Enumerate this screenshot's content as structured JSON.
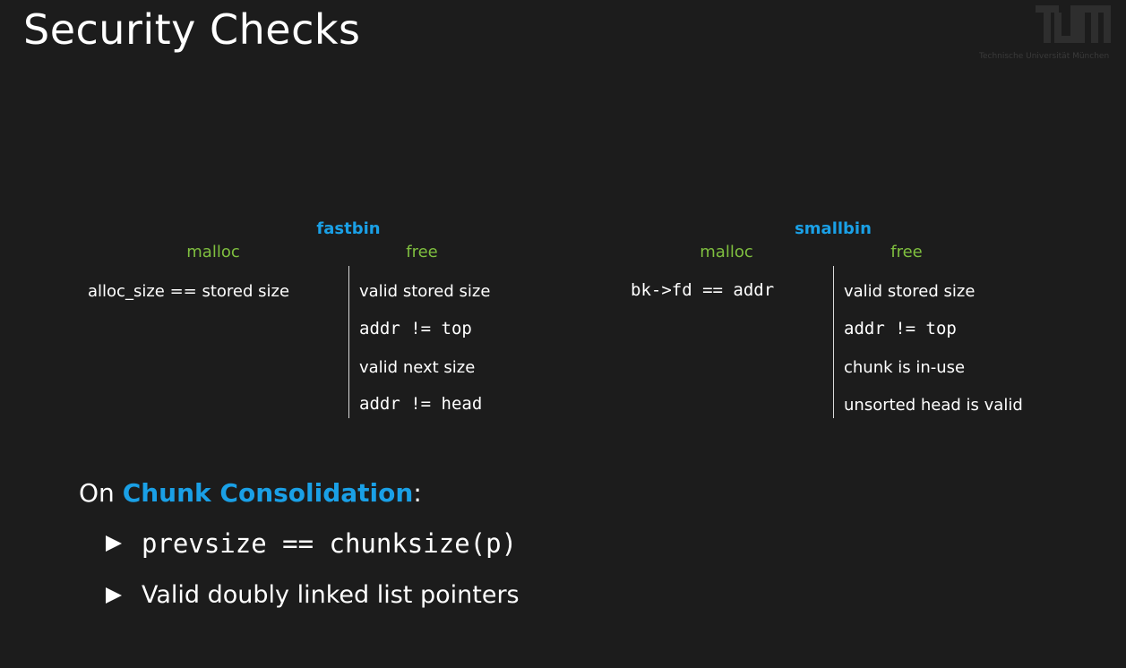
{
  "slide": {
    "title": "Security Checks",
    "logo": {
      "icon": "tum-logo-icon",
      "text": "TUM",
      "subtitle": "Technische Universität München",
      "color": "#2e2e2e"
    }
  },
  "fastbin": {
    "heading": "fastbin",
    "malloc": {
      "label": "malloc",
      "checks": [
        "alloc_size == stored size"
      ]
    },
    "free": {
      "label": "free",
      "checks": [
        "valid stored size",
        "addr != top",
        "valid next size",
        "addr != head"
      ]
    }
  },
  "smallbin": {
    "heading": "smallbin",
    "malloc": {
      "label": "malloc",
      "checks": [
        "bk->fd == addr"
      ]
    },
    "free": {
      "label": "free",
      "checks": [
        "valid stored size",
        "addr != top",
        "chunk is in-use",
        "unsorted head is valid"
      ]
    }
  },
  "consolidation": {
    "prefix": "On ",
    "emphasis": "Chunk Consolidation",
    "suffix": ":",
    "bullets": [
      "prevsize == chunksize(p)",
      "Valid doubly linked list pointers"
    ]
  },
  "colors": {
    "background": "#1c1c1c",
    "heading_blue": "#1aa0e6",
    "column_green": "#7fbf3f",
    "text": "#ffffff"
  }
}
